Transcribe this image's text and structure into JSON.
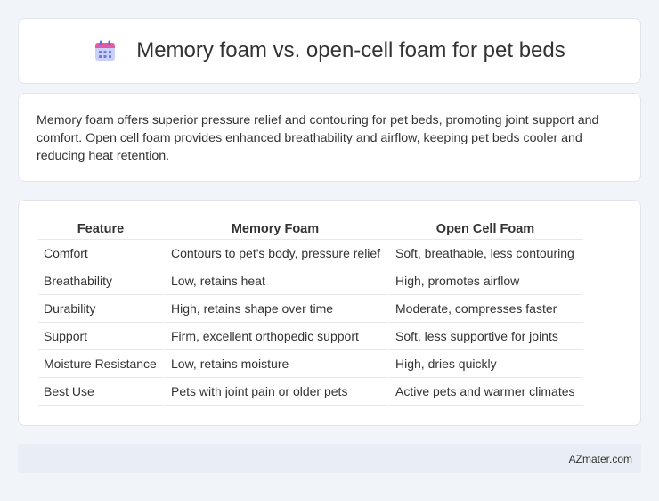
{
  "header": {
    "title": "Memory foam vs. open-cell foam for pet beds",
    "icon": "calendar-icon",
    "icon_colors": {
      "top": "#e55aa5",
      "body": "#9aa7f0",
      "dots": "#5a6bd8"
    }
  },
  "description": {
    "text": "Memory foam offers superior pressure relief and contouring for pet beds, promoting joint support and comfort. Open cell foam provides enhanced breathability and airflow, keeping pet beds cooler and reducing heat retention."
  },
  "table": {
    "headers": [
      "Feature",
      "Memory Foam",
      "Open Cell Foam"
    ],
    "rows": [
      [
        "Comfort",
        "Contours to pet's body, pressure relief",
        "Soft, breathable, less contouring"
      ],
      [
        "Breathability",
        "Low, retains heat",
        "High, promotes airflow"
      ],
      [
        "Durability",
        "High, retains shape over time",
        "Moderate, compresses faster"
      ],
      [
        "Support",
        "Firm, excellent orthopedic support",
        "Soft, less supportive for joints"
      ],
      [
        "Moisture Resistance",
        "Low, retains moisture",
        "High, dries quickly"
      ],
      [
        "Best Use",
        "Pets with joint pain or older pets",
        "Active pets and warmer climates"
      ]
    ]
  },
  "footer": {
    "brand": "AZmater.com"
  }
}
